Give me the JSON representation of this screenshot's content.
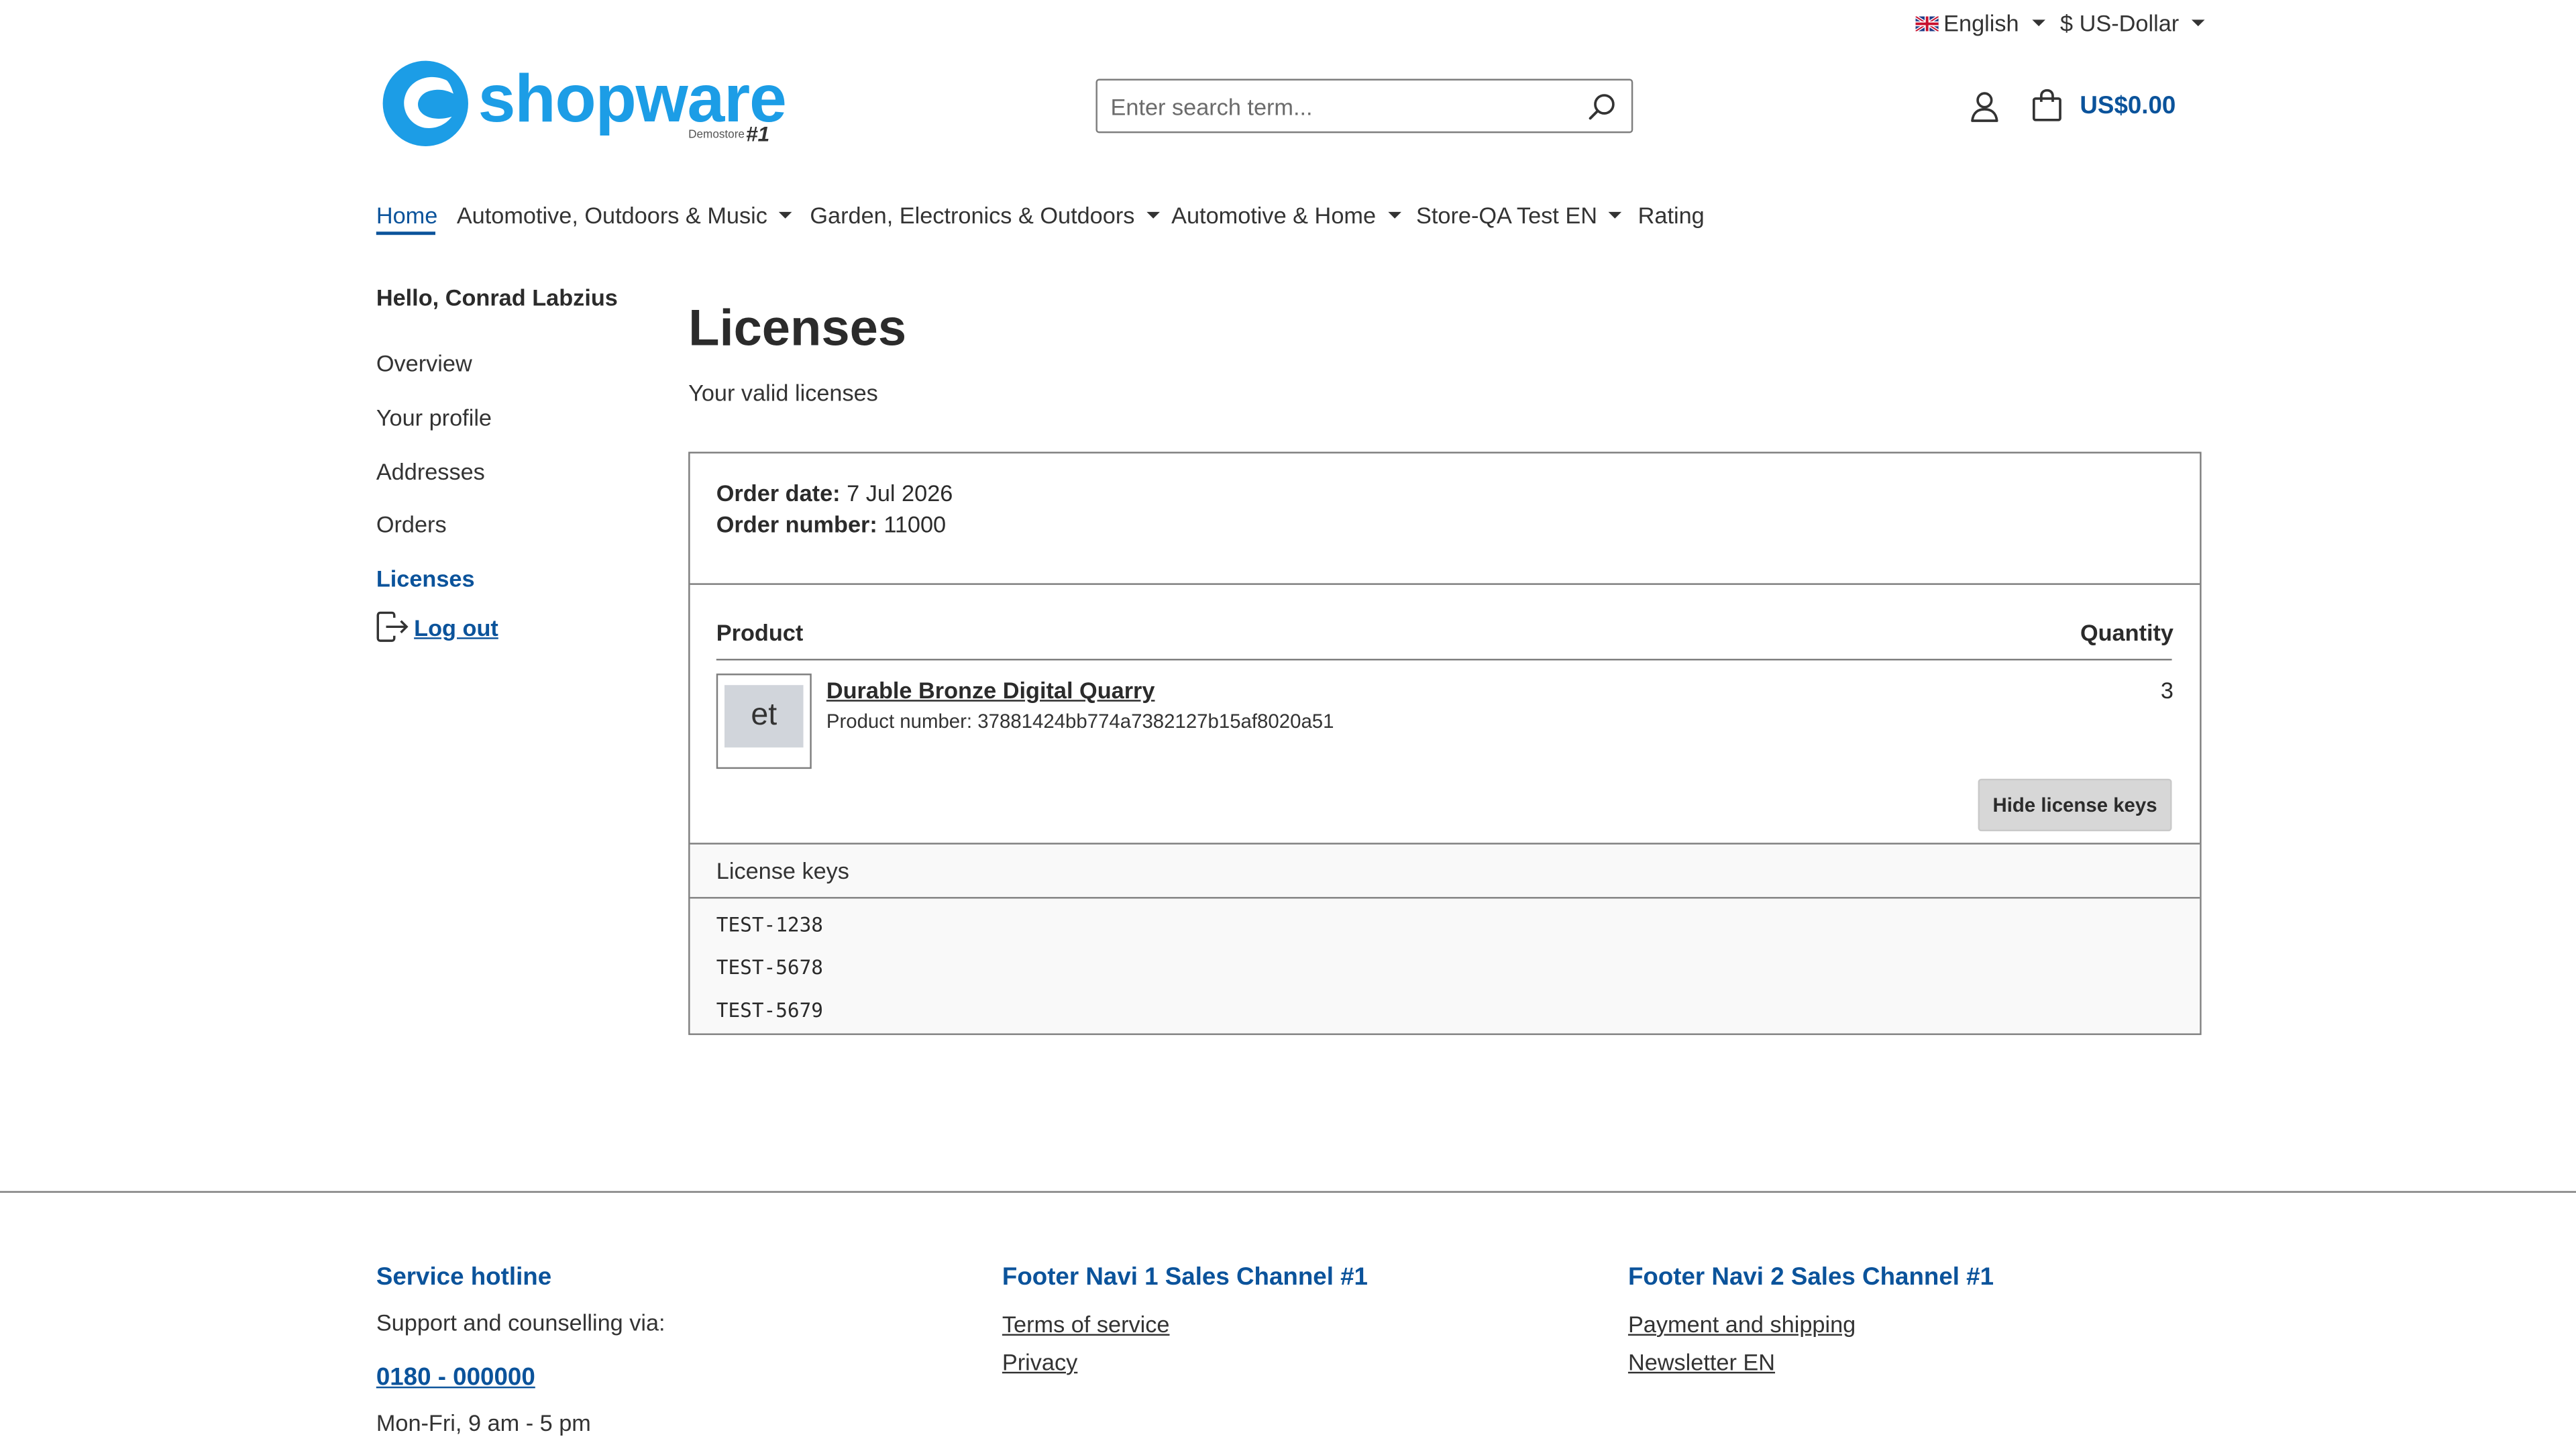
{
  "topbar": {
    "language": {
      "label": "English",
      "flag_icon": "uk-flag-icon"
    },
    "currency": {
      "label": "$ US-Dollar"
    }
  },
  "header": {
    "logo": {
      "word": "shopware",
      "sub": "Demostore",
      "num": "#1"
    },
    "search": {
      "placeholder": "Enter search term...",
      "value": ""
    },
    "cart": {
      "price": "US$0.00"
    }
  },
  "nav": {
    "items": [
      {
        "label": "Home",
        "active": true,
        "dropdown": false
      },
      {
        "label": "Automotive, Outdoors & Music",
        "active": false,
        "dropdown": true
      },
      {
        "label": "Garden, Electronics & Outdoors",
        "active": false,
        "dropdown": true
      },
      {
        "label": "Automotive & Home",
        "active": false,
        "dropdown": true
      },
      {
        "label": "Store-QA Test EN",
        "active": false,
        "dropdown": true
      },
      {
        "label": "Rating",
        "active": false,
        "dropdown": false
      }
    ]
  },
  "sidebar": {
    "greeting": "Hello, Conrad Labzius",
    "items": [
      {
        "label": "Overview"
      },
      {
        "label": "Your profile"
      },
      {
        "label": "Addresses"
      },
      {
        "label": "Orders"
      },
      {
        "label": "Licenses",
        "active": true
      }
    ],
    "logout": "Log out"
  },
  "main": {
    "title": "Licenses",
    "subtitle": "Your valid licenses",
    "order": {
      "date_label": "Order date:",
      "date_value": "7 Jul 2026",
      "number_label": "Order number:",
      "number_value": "11000"
    },
    "table": {
      "col_product": "Product",
      "col_quantity": "Quantity"
    },
    "product": {
      "thumb_text": "et",
      "name": "Durable Bronze Digital Quarry",
      "number_label": "Product number:",
      "number_value": "37881424bb774a7382127b15af8020a51",
      "quantity": "3"
    },
    "hide_keys_button": "Hide license keys",
    "license_keys": {
      "header": "License keys",
      "keys": [
        "TEST-1238",
        "TEST-5678",
        "TEST-5679"
      ]
    }
  },
  "footer": {
    "service": {
      "heading": "Service hotline",
      "text": "Support and counselling via:",
      "phone": "0180 - 000000",
      "hours": "Mon-Fri, 9 am - 5 pm"
    },
    "navi1": {
      "heading": "Footer Navi 1 Sales Channel #1",
      "links": [
        "Terms of service",
        "Privacy"
      ]
    },
    "navi2": {
      "heading": "Footer Navi 2 Sales Channel #1",
      "links": [
        "Payment and shipping",
        "Newsletter EN"
      ]
    }
  },
  "colors": {
    "accent": "#0b539b",
    "brand": "#1c9de6",
    "border": "#7e7e7e"
  }
}
